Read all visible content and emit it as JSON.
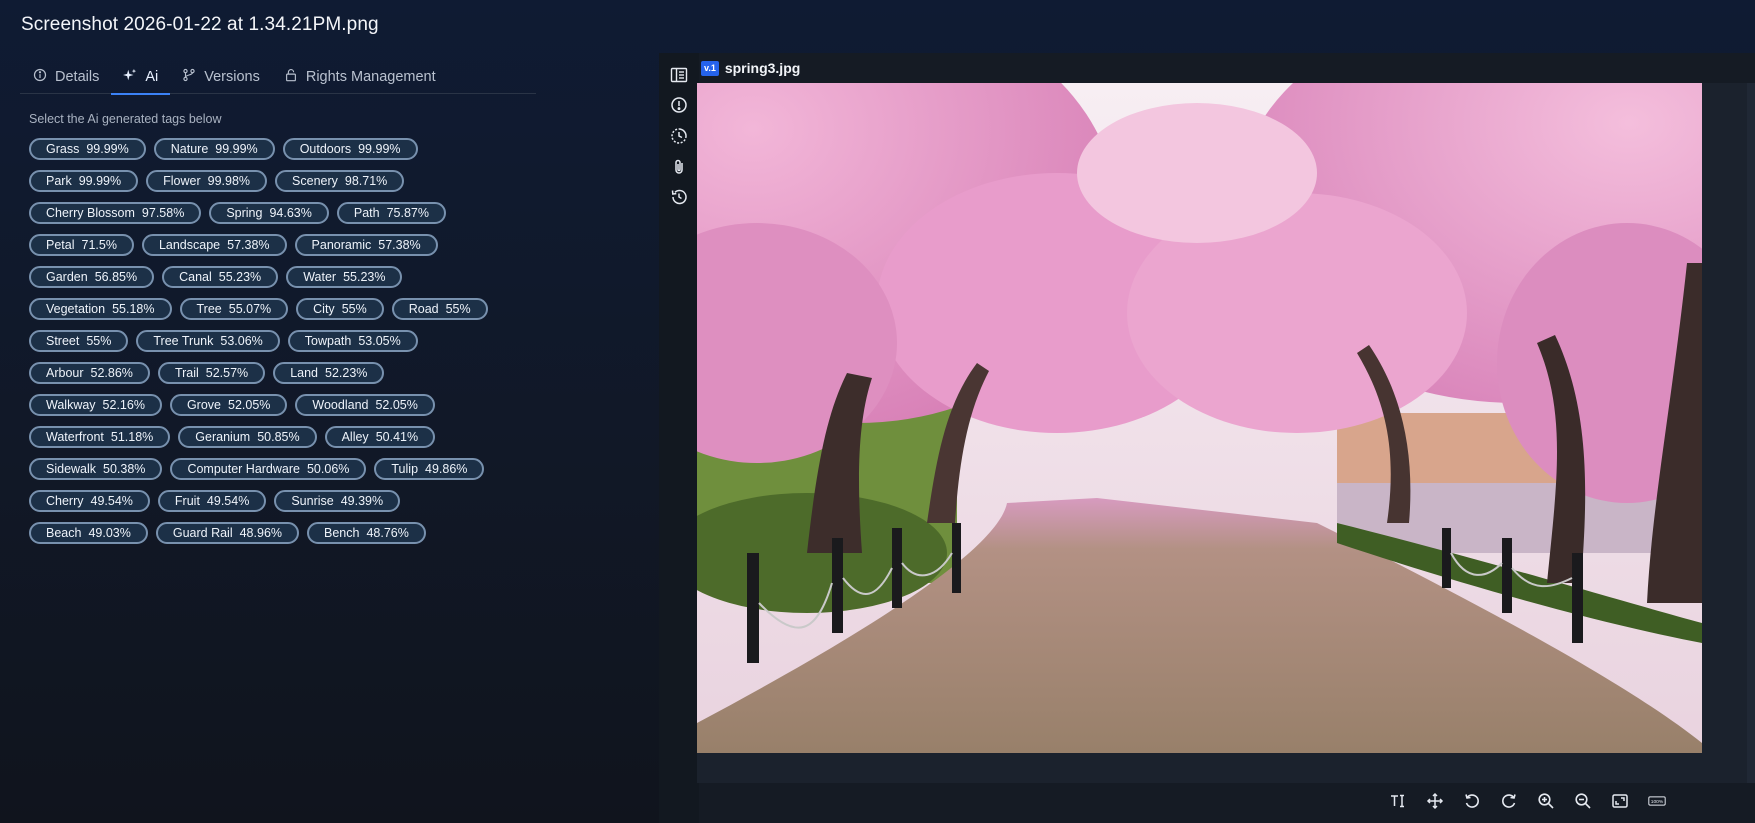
{
  "window": {
    "title": "Screenshot 2026-01-22 at 1.34.21PM.png"
  },
  "tabs": [
    {
      "label": "Details",
      "icon": "info-icon"
    },
    {
      "label": "Ai",
      "icon": "sparkle-icon",
      "active": true
    },
    {
      "label": "Versions",
      "icon": "versions-icon"
    },
    {
      "label": "Rights Management",
      "icon": "lock-icon"
    }
  ],
  "ai": {
    "subtitle": "Select the Ai generated tags below",
    "tag_rows": [
      [
        {
          "label": "Grass",
          "pct": "99.99%"
        },
        {
          "label": "Nature",
          "pct": "99.99%"
        },
        {
          "label": "Outdoors",
          "pct": "99.99%"
        }
      ],
      [
        {
          "label": "Park",
          "pct": "99.99%"
        },
        {
          "label": "Flower",
          "pct": "99.98%"
        },
        {
          "label": "Scenery",
          "pct": "98.71%"
        }
      ],
      [
        {
          "label": "Cherry Blossom",
          "pct": "97.58%"
        },
        {
          "label": "Spring",
          "pct": "94.63%"
        },
        {
          "label": "Path",
          "pct": "75.87%"
        }
      ],
      [
        {
          "label": "Petal",
          "pct": "71.5%"
        },
        {
          "label": "Landscape",
          "pct": "57.38%"
        },
        {
          "label": "Panoramic",
          "pct": "57.38%"
        }
      ],
      [
        {
          "label": "Garden",
          "pct": "56.85%"
        },
        {
          "label": "Canal",
          "pct": "55.23%"
        },
        {
          "label": "Water",
          "pct": "55.23%"
        }
      ],
      [
        {
          "label": "Vegetation",
          "pct": "55.18%"
        },
        {
          "label": "Tree",
          "pct": "55.07%"
        },
        {
          "label": "City",
          "pct": "55%"
        },
        {
          "label": "Road",
          "pct": "55%"
        }
      ],
      [
        {
          "label": "Street",
          "pct": "55%"
        },
        {
          "label": "Tree Trunk",
          "pct": "53.06%"
        },
        {
          "label": "Towpath",
          "pct": "53.05%"
        }
      ],
      [
        {
          "label": "Arbour",
          "pct": "52.86%"
        },
        {
          "label": "Trail",
          "pct": "52.57%"
        },
        {
          "label": "Land",
          "pct": "52.23%"
        }
      ],
      [
        {
          "label": "Walkway",
          "pct": "52.16%"
        },
        {
          "label": "Grove",
          "pct": "52.05%"
        },
        {
          "label": "Woodland",
          "pct": "52.05%"
        }
      ],
      [
        {
          "label": "Waterfront",
          "pct": "51.18%"
        },
        {
          "label": "Geranium",
          "pct": "50.85%"
        },
        {
          "label": "Alley",
          "pct": "50.41%"
        }
      ],
      [
        {
          "label": "Sidewalk",
          "pct": "50.38%"
        },
        {
          "label": "Computer Hardware",
          "pct": "50.06%"
        },
        {
          "label": "Tulip",
          "pct": "49.86%"
        }
      ],
      [
        {
          "label": "Cherry",
          "pct": "49.54%"
        },
        {
          "label": "Fruit",
          "pct": "49.54%"
        },
        {
          "label": "Sunrise",
          "pct": "49.39%"
        }
      ],
      [
        {
          "label": "Beach",
          "pct": "49.03%"
        },
        {
          "label": "Guard Rail",
          "pct": "48.96%"
        },
        {
          "label": "Bench",
          "pct": "48.76%"
        }
      ]
    ]
  },
  "viewer": {
    "version_badge": "v.1",
    "file_name": "spring3.jpg",
    "side_icons": [
      "sidebar-panel-icon",
      "info-icon",
      "history-clock-icon",
      "attachment-icon",
      "restore-icon"
    ],
    "toolbar_icons": [
      "text-cursor-icon",
      "move-icon",
      "rotate-left-icon",
      "rotate-right-icon",
      "zoom-in-icon",
      "zoom-out-icon",
      "fit-screen-icon",
      "actual-size-icon"
    ],
    "actual_size_label": "100%"
  },
  "colors": {
    "accent": "#3b82f6",
    "tag_border": "#7891ae",
    "tag_bg": "#1c3047",
    "badge": "#2563eb"
  }
}
